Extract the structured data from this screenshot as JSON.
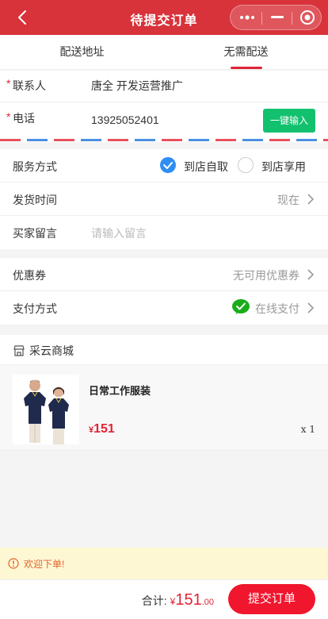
{
  "header": {
    "title": "待提交订单"
  },
  "tabs": [
    {
      "label": "配送地址",
      "active": false
    },
    {
      "label": "无需配送",
      "active": true
    }
  ],
  "contact": {
    "required_mark": "*",
    "name_label": "联系人",
    "name_value": "唐全 开发运营推广",
    "phone_label": "电话",
    "phone_value": "13925052401",
    "quick_fill_label": "一键输入"
  },
  "options": {
    "service_label": "服务方式",
    "service_choices": [
      {
        "label": "到店自取",
        "checked": true
      },
      {
        "label": "到店享用",
        "checked": false
      }
    ],
    "ship_time_label": "发货时间",
    "ship_time_value": "现在",
    "message_label": "买家留言",
    "message_placeholder": "请输入留言"
  },
  "payment": {
    "coupon_label": "优惠券",
    "coupon_value": "无可用优惠券",
    "pay_label": "支付方式",
    "pay_value": "在线支付"
  },
  "shop": {
    "name": "采云商城"
  },
  "product": {
    "name": "日常工作服装",
    "currency": "¥",
    "price": "151",
    "qty": "x 1"
  },
  "notice": {
    "text": "欢迎下单!"
  },
  "footer": {
    "total_label": "合计:",
    "currency": "¥",
    "total_int": "151",
    "total_dec": ".00",
    "submit_label": "提交订单"
  },
  "colors": {
    "brand": "#d8323a",
    "accent_red": "#f0162e",
    "green": "#12c16e",
    "radio_blue": "#2f8ef4",
    "wechat_green": "#1aad19"
  }
}
